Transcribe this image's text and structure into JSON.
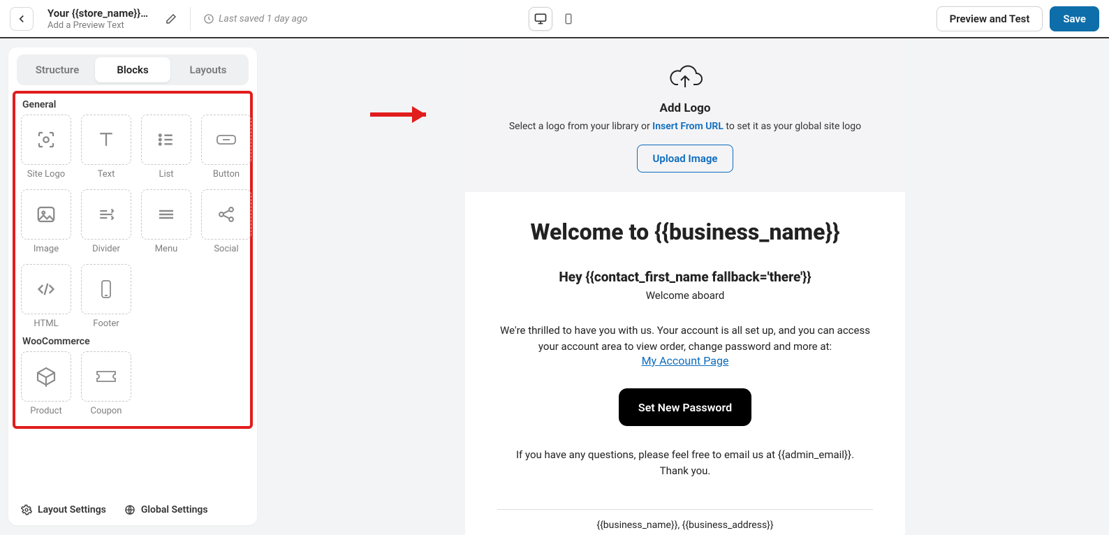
{
  "header": {
    "title": "Your {{store_name}}…",
    "preview_placeholder": "Add a Preview Text",
    "last_saved": "Last saved 1 day ago",
    "preview_test_label": "Preview and Test",
    "save_label": "Save"
  },
  "tabs": {
    "structure": "Structure",
    "blocks": "Blocks",
    "layouts": "Layouts"
  },
  "sections": {
    "general": "General",
    "woocommerce": "WooCommerce"
  },
  "blocks": {
    "site_logo": "Site Logo",
    "text": "Text",
    "list": "List",
    "button": "Button",
    "image": "Image",
    "divider": "Divider",
    "menu": "Menu",
    "social": "Social",
    "html": "HTML",
    "footer": "Footer",
    "product": "Product",
    "coupon": "Coupon"
  },
  "sidebar_footer": {
    "layout": "Layout Settings",
    "global": "Global Settings"
  },
  "canvas": {
    "add_logo_title": "Add Logo",
    "add_logo_text_pre": "Select a logo from your library or ",
    "add_logo_link": "Insert From URL",
    "add_logo_text_post": " to set it as your global site logo",
    "upload_btn": "Upload Image",
    "welcome_heading": "Welcome to {{business_name}}",
    "hey_line": "Hey {{contact_first_name fallback='there'}}",
    "welcome_aboard": "Welcome aboard",
    "thrilled": "We're thrilled to have you with us. Your account is all set up, and you can access your account area to view order, change password and more at:",
    "account_link": "My Account Page",
    "set_pwd_btn": "Set New Password",
    "questions": "If you have any questions, please feel free to email us at {{admin_email}}.",
    "thankyou": "Thank you.",
    "footer_text": "{{business_name}}, {{business_address}}"
  }
}
